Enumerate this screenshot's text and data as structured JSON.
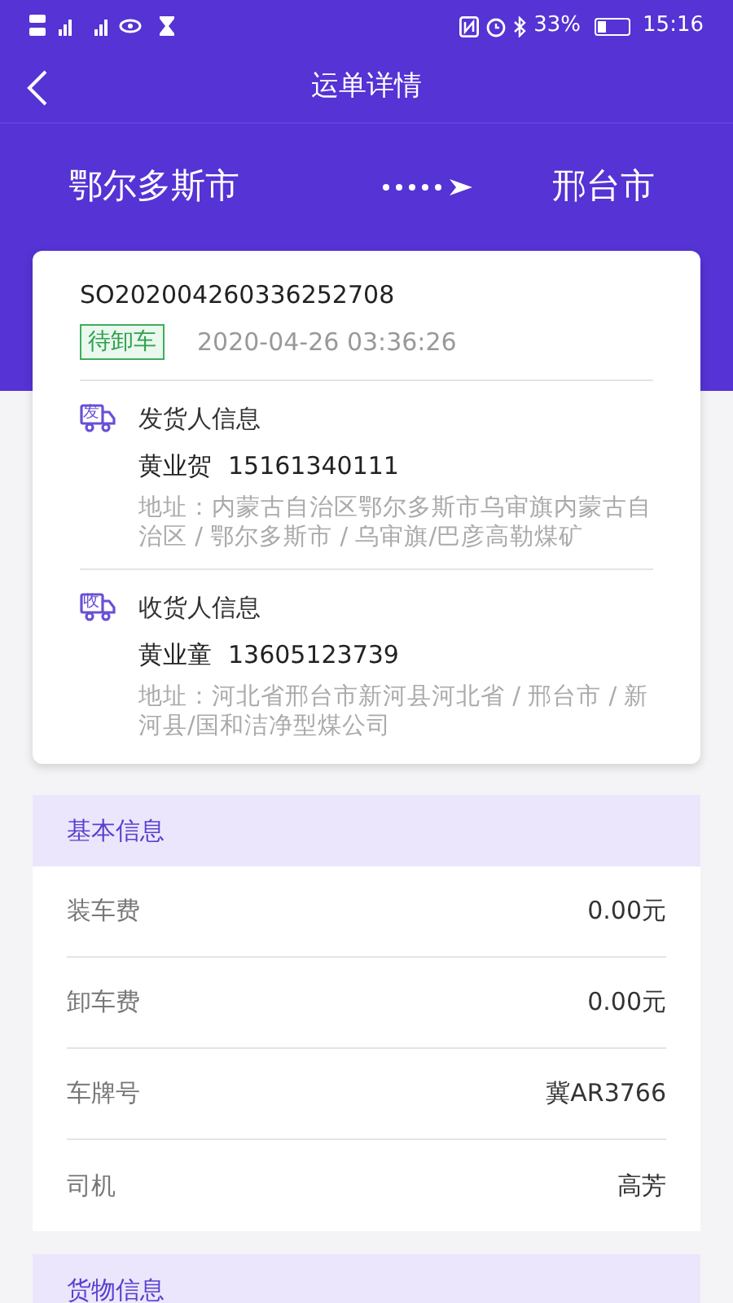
{
  "status_bar": {
    "battery_text": "33%",
    "time": "15:16"
  },
  "header": {
    "title": "运单详情"
  },
  "route": {
    "from": "鄂尔多斯市",
    "to": "邢台市"
  },
  "order": {
    "number": "SO202004260336252708",
    "status": "待卸车",
    "time": "2020-04-26 03:36:26",
    "parties": [
      {
        "icon_label": "发",
        "title": "发货人信息",
        "name": "黄业贺",
        "phone": "15161340111",
        "address": "地址：内蒙古自治区鄂尔多斯市乌审旗内蒙古自治区 / 鄂尔多斯市 / 乌审旗/巴彦高勒煤矿"
      },
      {
        "icon_label": "收",
        "title": "收货人信息",
        "name": "黄业童",
        "phone": "13605123739",
        "address": "地址：河北省邢台市新河县河北省 / 邢台市 / 新河县/国和洁净型煤公司"
      }
    ]
  },
  "basic_info": {
    "title": "基本信息",
    "rows": [
      {
        "label": "装车费",
        "value": "0.00元"
      },
      {
        "label": "卸车费",
        "value": "0.00元"
      },
      {
        "label": "车牌号",
        "value": "冀AR3766"
      },
      {
        "label": "司机",
        "value": "高芳"
      }
    ]
  },
  "cargo_info": {
    "title": "货物信息"
  }
}
